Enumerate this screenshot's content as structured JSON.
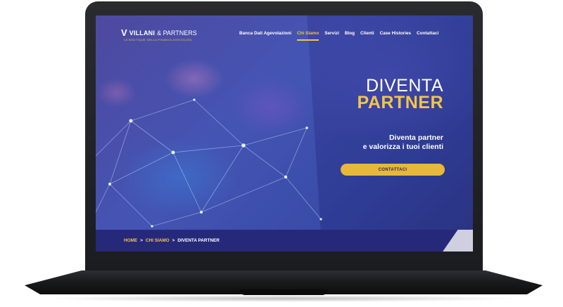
{
  "brand": {
    "logo_letter": "V",
    "name": "VILLANI",
    "amp": "& PARTNERS",
    "tagline": "LA BOUTIQUE DELLA FINANZA AGEVOLATA"
  },
  "nav": {
    "items": [
      {
        "label": "Banca Dati Agevolazioni",
        "active": false
      },
      {
        "label": "Chi Siamo",
        "active": true
      },
      {
        "label": "Servizi",
        "active": false
      },
      {
        "label": "Blog",
        "active": false
      },
      {
        "label": "Clienti",
        "active": false
      },
      {
        "label": "Case Histories",
        "active": false
      },
      {
        "label": "Contattaci",
        "active": false
      }
    ]
  },
  "hero": {
    "line1": "DIVENTA",
    "line2": "PARTNER",
    "sub1": "Diventa partner",
    "sub2": "e valorizza i tuoi clienti",
    "cta_label": "CONTATTACI"
  },
  "breadcrumb": {
    "home": "HOME",
    "sep1": ">",
    "section": "CHI SIAMO",
    "sep2": ">",
    "current": "DIVENTA PARTNER"
  },
  "colors": {
    "accent": "#f2c44b",
    "cta": "#e7b83a",
    "band": "#26297a",
    "hero_bg": "#3c4aa8"
  }
}
